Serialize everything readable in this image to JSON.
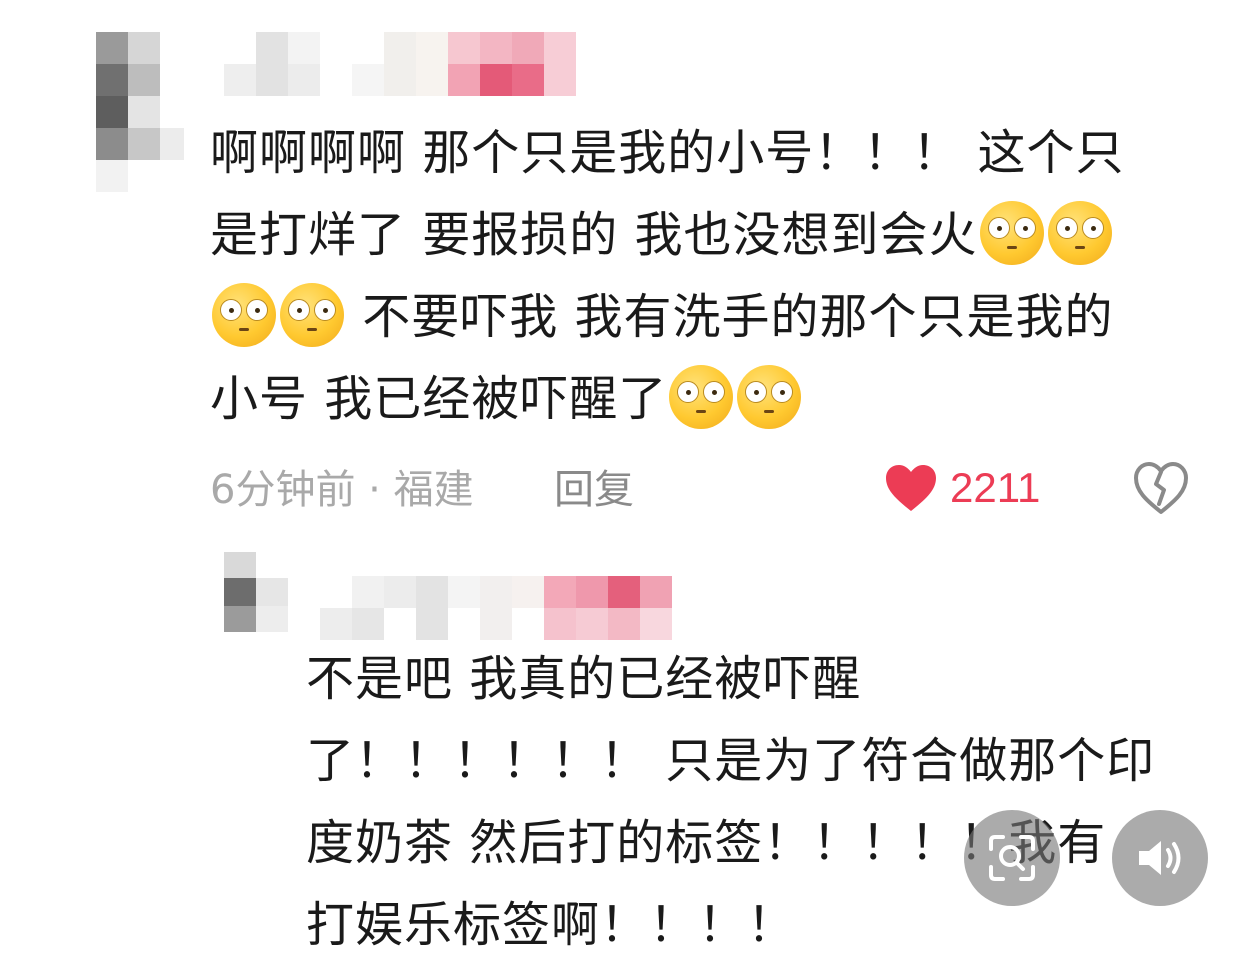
{
  "comment": {
    "lines": [
      "啊啊啊啊 那个只是我的小号！！！ 这个只",
      "是打烊了 要报损的 我也没想到会火",
      "不要吓我 我有洗手的那个只是我的",
      "小号 我已经被吓醒了"
    ],
    "time_location": "6分钟前 · 福建",
    "reply_label": "回复",
    "like_count": "2211"
  },
  "reply": {
    "lines": [
      "不是吧 我真的已经被吓醒",
      "了！！！！！！ 只是为了符合做那个印",
      "度奶茶 然后打的标签！！！！！我有",
      "打娱乐标签啊！！！！"
    ]
  },
  "colors": {
    "like_red": "#ec3c55",
    "meta_gray": "#a9a9a9",
    "emoji_yellow": "#ffc930"
  },
  "icons": {
    "like": "heart-icon",
    "dislike": "broken-heart-icon",
    "scan": "scan-search-icon",
    "sound": "speaker-icon",
    "emoji": "flushed-face-emoji"
  }
}
